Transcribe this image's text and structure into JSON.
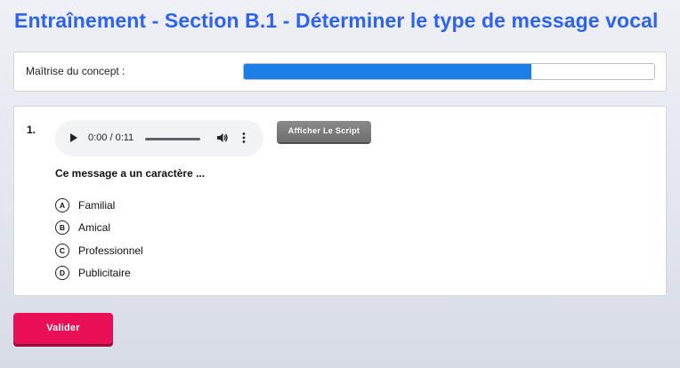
{
  "page": {
    "title": "Entraînement - Section B.1 - Déterminer le type de message vocal"
  },
  "mastery": {
    "label": "Maîtrise du concept :",
    "progress_fraction": 0.7,
    "fill_color": "#1a7fe6"
  },
  "question": {
    "number": "1.",
    "audio": {
      "time": "0:00 / 0:11",
      "play_icon": "play-icon",
      "volume_icon": "volume-icon",
      "menu_icon": "more-vert-icon"
    },
    "script_button_label": "Afficher Le Script",
    "prompt": "Ce message a un caractère ...",
    "options": [
      {
        "letter": "A",
        "label": "Familial"
      },
      {
        "letter": "B",
        "label": "Amical"
      },
      {
        "letter": "C",
        "label": "Professionnel"
      },
      {
        "letter": "D",
        "label": "Publicitaire"
      }
    ]
  },
  "actions": {
    "validate_label": "Valider",
    "validate_color": "#e80f57"
  },
  "colors": {
    "title": "#2e63f0"
  }
}
